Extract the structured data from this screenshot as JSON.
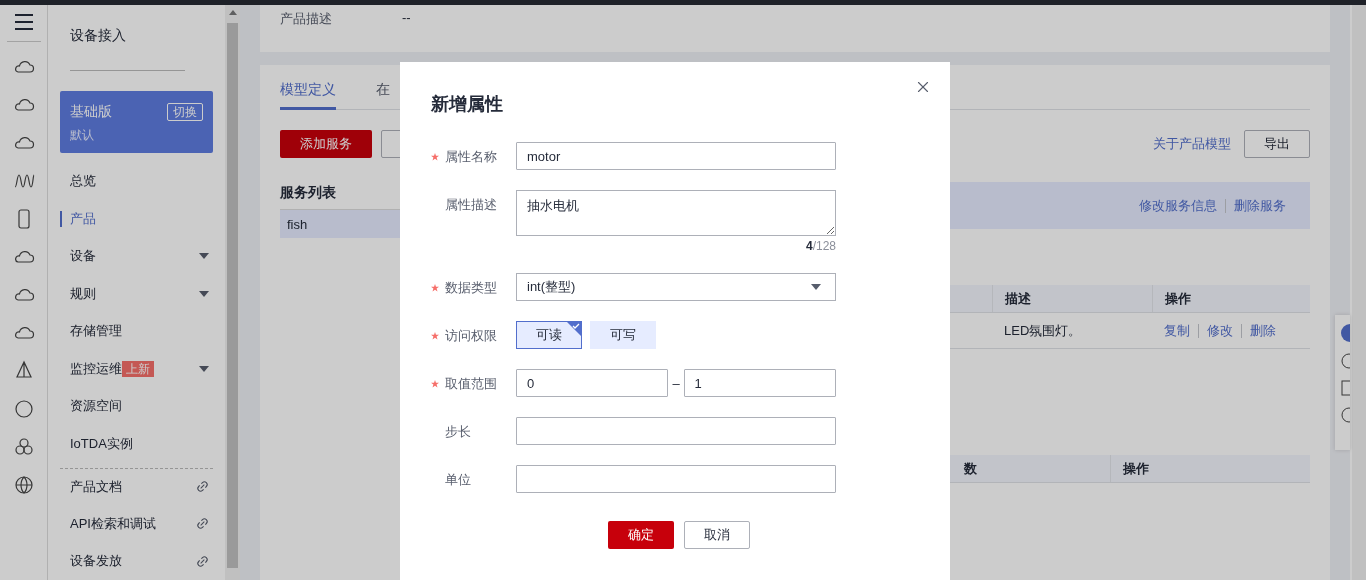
{
  "sidebar": {
    "title": "设备接入",
    "edition": {
      "name": "基础版",
      "switch": "切换",
      "instance": "默认"
    },
    "items": [
      {
        "label": "总览",
        "selected": false,
        "expandable": false,
        "link": false
      },
      {
        "label": "产品",
        "selected": true,
        "expandable": false,
        "link": false
      },
      {
        "label": "设备",
        "selected": false,
        "expandable": true,
        "link": false
      },
      {
        "label": "规则",
        "selected": false,
        "expandable": true,
        "link": false
      },
      {
        "label": "存储管理",
        "selected": false,
        "expandable": false,
        "link": false
      },
      {
        "label": "监控运维",
        "selected": false,
        "expandable": true,
        "link": false,
        "badge": "上新"
      },
      {
        "label": "资源空间",
        "selected": false,
        "expandable": false,
        "link": false
      },
      {
        "label": "IoTDA实例",
        "selected": false,
        "expandable": false,
        "link": false
      },
      {
        "label": "产品文档",
        "selected": false,
        "expandable": false,
        "link": true
      },
      {
        "label": "API检索和调试",
        "selected": false,
        "expandable": false,
        "link": true
      },
      {
        "label": "设备发放",
        "selected": false,
        "expandable": false,
        "link": true
      }
    ]
  },
  "product_info": {
    "label": "产品描述",
    "value": "--"
  },
  "tabs": [
    {
      "label": "模型定义",
      "selected": true
    },
    {
      "label": "在",
      "selected": false
    }
  ],
  "toolbar": {
    "add_button": "添加服务",
    "about_link": "关于产品模型",
    "export_button": "导出"
  },
  "services": {
    "title": "服务列表",
    "items": [
      {
        "name": "fish",
        "selected": true
      }
    ],
    "actions": [
      "修改服务信息",
      "删除服务"
    ]
  },
  "properties_table": {
    "columns": [
      "描述",
      "操作"
    ],
    "rows": [
      {
        "description": "LED氛围灯。",
        "actions": [
          "复制",
          "修改",
          "删除"
        ]
      }
    ]
  },
  "commands_table": {
    "columns": [
      "数",
      "操作"
    ]
  },
  "dialog": {
    "title": "新增属性",
    "fields": [
      {
        "kind": "text",
        "label": "属性名称",
        "required": true,
        "value": "motor"
      },
      {
        "kind": "textarea",
        "label": "属性描述",
        "required": false,
        "value": "抽水电机",
        "count": "4",
        "limit": "/128"
      },
      {
        "kind": "select",
        "label": "数据类型",
        "required": true,
        "value": "int(整型)"
      },
      {
        "kind": "toggle",
        "label": "访问权限",
        "required": true,
        "options": [
          {
            "label": "可读",
            "selected": true
          },
          {
            "label": "可写",
            "selected": false
          }
        ]
      },
      {
        "kind": "range",
        "label": "取值范围",
        "required": true,
        "min": "0",
        "separator": "–",
        "max": "1"
      },
      {
        "kind": "text",
        "label": "步长",
        "required": false
      },
      {
        "kind": "text",
        "label": "单位",
        "required": false
      }
    ],
    "confirm": "确定",
    "cancel": "取消"
  }
}
